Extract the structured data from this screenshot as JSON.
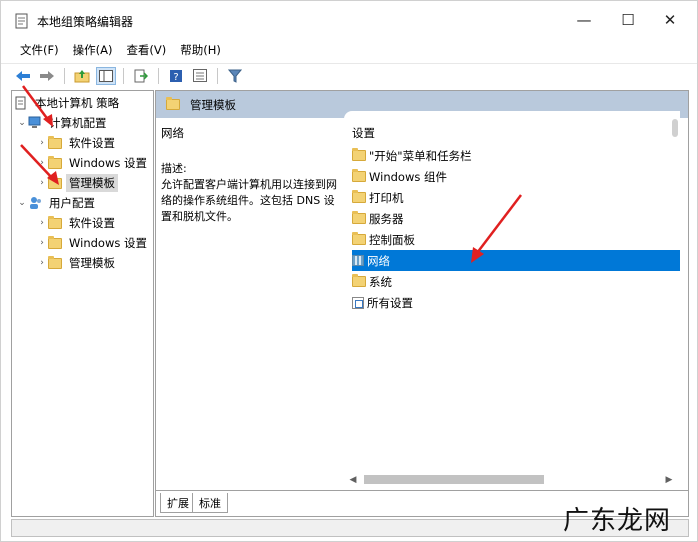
{
  "window": {
    "title": "本地组策略编辑器",
    "minimize_label": "—",
    "maximize_label": "☐",
    "close_label": "✕"
  },
  "menu": [
    "文件(F)",
    "操作(A)",
    "查看(V)",
    "帮助(H)"
  ],
  "toolbar": {
    "icons": [
      "back-arrow-icon",
      "forward-arrow-icon",
      "up-folder-icon",
      "show-hide-tree-icon",
      "export-list-icon",
      "help-icon",
      "properties-icon",
      "filter-icon"
    ]
  },
  "tree": {
    "root": "本地计算机 策略",
    "computer_config": "计算机配置",
    "computer_children": [
      "软件设置",
      "Windows 设置",
      "管理模板"
    ],
    "user_config": "用户配置",
    "user_children": [
      "软件设置",
      "Windows 设置",
      "管理模板"
    ]
  },
  "right_pane": {
    "header": "管理模板",
    "description_heading": "网络",
    "description_label": "描述:",
    "description_text": "允许配置客户端计算机用以连接到网络的操作系统组件。这包括 DNS 设置和脱机文件。",
    "settings_heading": "设置",
    "settings_items": [
      "\"开始\"菜单和任务栏",
      "Windows 组件",
      "打印机",
      "服务器",
      "控制面板",
      "网络",
      "系统",
      "所有设置"
    ],
    "selected_item": "网络"
  },
  "tabs": [
    "扩展",
    "标准"
  ],
  "watermark": "广东龙网",
  "colors": {
    "selection": "#0078d7",
    "header_band": "#b9c9dc",
    "arrow": "#e02020"
  }
}
